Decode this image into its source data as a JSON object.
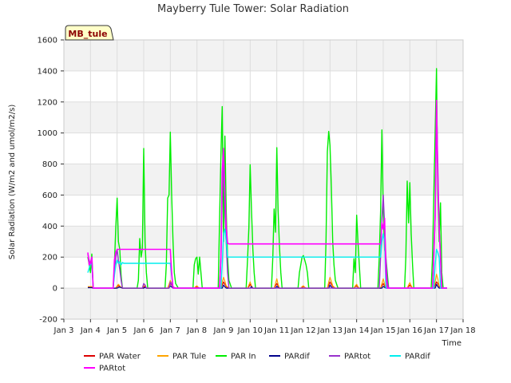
{
  "chart_data": {
    "type": "line",
    "title": "Mayberry Tule Tower: Solar Radiation",
    "xlabel": "Time",
    "ylabel": "Solar Radiation (W/m2 and umol/m2/s)",
    "badge": "MB_tule",
    "xlim": [
      3,
      18
    ],
    "ylim": [
      -200,
      1600
    ],
    "x_ticks": [
      3,
      4,
      5,
      6,
      7,
      8,
      9,
      10,
      11,
      12,
      13,
      14,
      15,
      16,
      17,
      18
    ],
    "x_tick_labels": [
      "Jan 3",
      "Jan 4",
      "Jan 5",
      "Jan 6",
      "Jan 7",
      "Jan 8",
      "Jan 9",
      "Jan 10",
      "Jan 11",
      "Jan 12",
      "Jan 13",
      "Jan 14",
      "Jan 15",
      "Jan 16",
      "Jan 17",
      "Jan 18"
    ],
    "y_ticks": [
      -200,
      0,
      200,
      400,
      600,
      800,
      1000,
      1200,
      1400,
      1600
    ],
    "y_tick_labels": [
      "-200",
      "0",
      "200",
      "400",
      "600",
      "800",
      "1000",
      "1200",
      "1400",
      "1600"
    ],
    "bands": [
      [
        -200,
        0
      ],
      [
        200,
        400
      ],
      [
        600,
        800
      ],
      [
        1000,
        1200
      ],
      [
        1400,
        1600
      ]
    ],
    "series": [
      {
        "name": "PAR Water",
        "color": "#dd0000",
        "width": 1.2,
        "x": [
          3.9,
          4.05,
          4.1,
          4.5,
          4.95,
          5.0,
          5.05,
          5.1,
          5.15,
          5.2,
          5.3,
          5.95,
          6.0,
          6.05,
          6.1,
          6.9,
          6.95,
          7.0,
          7.05,
          7.1,
          7.2,
          7.9,
          7.95,
          8.0,
          8.05,
          8.1,
          8.9,
          8.95,
          9.0,
          9.05,
          9.1,
          9.2,
          9.9,
          9.95,
          10.0,
          10.05,
          10.1,
          10.9,
          10.95,
          11.0,
          11.05,
          11.1,
          11.9,
          11.95,
          12.0,
          12.05,
          12.1,
          12.9,
          12.95,
          13.0,
          13.05,
          13.1,
          13.2,
          13.9,
          13.95,
          14.0,
          14.05,
          14.1,
          14.9,
          14.95,
          15.0,
          15.05,
          15.1,
          15.2,
          15.9,
          15.95,
          16.0,
          16.05,
          16.1,
          16.9,
          16.95,
          17.0,
          17.05,
          17.1,
          17.2,
          17.4
        ],
        "y": [
          5,
          5,
          0,
          0,
          0,
          10,
          15,
          10,
          5,
          0,
          0,
          0,
          8,
          10,
          0,
          0,
          15,
          30,
          20,
          5,
          0,
          0,
          5,
          8,
          3,
          0,
          0,
          20,
          40,
          25,
          10,
          0,
          0,
          10,
          25,
          10,
          0,
          0,
          15,
          30,
          15,
          0,
          0,
          5,
          10,
          5,
          0,
          0,
          20,
          40,
          25,
          10,
          0,
          0,
          10,
          15,
          5,
          0,
          0,
          15,
          30,
          15,
          5,
          0,
          0,
          10,
          20,
          10,
          0,
          0,
          20,
          40,
          30,
          10,
          0,
          0
        ]
      },
      {
        "name": "PAR Tule",
        "color": "#ffa500",
        "width": 1.2,
        "x": [
          3.9,
          4.05,
          4.1,
          4.5,
          4.95,
          5.0,
          5.05,
          5.1,
          5.15,
          5.2,
          5.3,
          5.95,
          6.0,
          6.05,
          6.1,
          6.9,
          6.95,
          7.0,
          7.05,
          7.1,
          7.2,
          7.9,
          7.95,
          8.0,
          8.05,
          8.1,
          8.9,
          8.95,
          9.0,
          9.05,
          9.1,
          9.2,
          9.9,
          9.95,
          10.0,
          10.05,
          10.1,
          10.9,
          10.95,
          11.0,
          11.05,
          11.1,
          11.9,
          11.95,
          12.0,
          12.05,
          12.1,
          12.9,
          12.95,
          13.0,
          13.05,
          13.1,
          13.2,
          13.9,
          13.95,
          14.0,
          14.05,
          14.1,
          14.9,
          14.95,
          15.0,
          15.05,
          15.1,
          15.2,
          15.9,
          15.95,
          16.0,
          16.05,
          16.1,
          16.9,
          16.95,
          17.0,
          17.05,
          17.1,
          17.2,
          17.4
        ],
        "y": [
          10,
          10,
          0,
          0,
          0,
          15,
          25,
          15,
          5,
          0,
          0,
          0,
          15,
          20,
          0,
          0,
          25,
          50,
          30,
          10,
          0,
          0,
          10,
          15,
          5,
          0,
          0,
          40,
          70,
          45,
          15,
          0,
          0,
          20,
          40,
          15,
          0,
          0,
          30,
          60,
          25,
          0,
          0,
          10,
          15,
          5,
          0,
          0,
          40,
          70,
          45,
          15,
          0,
          0,
          15,
          25,
          10,
          0,
          0,
          30,
          60,
          25,
          5,
          0,
          0,
          20,
          35,
          15,
          0,
          0,
          40,
          90,
          60,
          15,
          0,
          0
        ]
      },
      {
        "name": "PAR In",
        "color": "#00ee00",
        "width": 1.4,
        "x": [
          3.9,
          3.95,
          4.0,
          4.05,
          4.1,
          4.15,
          4.2,
          4.5,
          4.85,
          4.9,
          4.95,
          5.0,
          5.05,
          5.1,
          5.15,
          5.2,
          5.3,
          5.75,
          5.8,
          5.85,
          5.9,
          5.95,
          6.0,
          6.05,
          6.1,
          6.15,
          6.2,
          6.5,
          6.8,
          6.85,
          6.9,
          6.95,
          7.0,
          7.05,
          7.1,
          7.15,
          7.2,
          7.3,
          7.8,
          7.85,
          7.9,
          7.95,
          8.0,
          8.05,
          8.1,
          8.2,
          8.8,
          8.85,
          8.9,
          8.95,
          9.0,
          9.05,
          9.1,
          9.15,
          9.2,
          9.3,
          9.8,
          9.85,
          9.9,
          9.95,
          10.0,
          10.05,
          10.1,
          10.15,
          10.2,
          10.8,
          10.85,
          10.9,
          10.95,
          11.0,
          11.05,
          11.1,
          11.15,
          11.2,
          11.8,
          11.85,
          11.9,
          11.95,
          12.0,
          12.05,
          12.1,
          12.15,
          12.2,
          12.8,
          12.85,
          12.9,
          12.95,
          13.0,
          13.05,
          13.1,
          13.15,
          13.2,
          13.3,
          13.8,
          13.85,
          13.9,
          13.95,
          14.0,
          14.05,
          14.1,
          14.15,
          14.8,
          14.85,
          14.9,
          14.95,
          15.0,
          15.05,
          15.1,
          15.15,
          15.2,
          15.3,
          15.8,
          15.85,
          15.9,
          15.95,
          16.0,
          16.05,
          16.1,
          16.15,
          16.2,
          16.8,
          16.85,
          16.9,
          16.95,
          17.0,
          17.05,
          17.1,
          17.15,
          17.2,
          17.25,
          17.4
        ],
        "y": [
          200,
          150,
          100,
          220,
          0,
          0,
          0,
          0,
          0,
          150,
          390,
          580,
          300,
          250,
          80,
          0,
          0,
          0,
          50,
          320,
          200,
          250,
          900,
          300,
          100,
          0,
          0,
          0,
          0,
          150,
          580,
          600,
          1005,
          600,
          300,
          100,
          30,
          0,
          0,
          0,
          150,
          190,
          200,
          90,
          200,
          0,
          0,
          440,
          860,
          1170,
          300,
          980,
          500,
          200,
          50,
          0,
          0,
          0,
          180,
          390,
          795,
          500,
          250,
          100,
          0,
          0,
          200,
          510,
          360,
          905,
          500,
          270,
          100,
          0,
          0,
          100,
          150,
          200,
          210,
          180,
          150,
          100,
          0,
          0,
          300,
          880,
          1010,
          920,
          650,
          300,
          150,
          50,
          0,
          0,
          0,
          190,
          100,
          470,
          300,
          150,
          0,
          0,
          200,
          500,
          1020,
          500,
          250,
          200,
          100,
          0,
          0,
          0,
          200,
          690,
          420,
          680,
          350,
          150,
          0,
          0,
          0,
          200,
          590,
          1000,
          1415,
          600,
          300,
          550,
          100,
          0,
          0
        ]
      },
      {
        "name": "PARdif",
        "color": "#00008b",
        "width": 1.2,
        "x": [
          3.9,
          4.05,
          4.1,
          4.5,
          5.0,
          5.1,
          5.15,
          5.2,
          6.0,
          6.05,
          6.1,
          6.95,
          7.0,
          7.05,
          7.1,
          8.0,
          8.05,
          8.1,
          8.95,
          9.0,
          9.05,
          9.1,
          10.0,
          10.05,
          10.1,
          10.95,
          11.0,
          11.05,
          11.1,
          12.95,
          13.0,
          13.05,
          13.1,
          14.95,
          15.0,
          15.05,
          15.1,
          16.95,
          17.0,
          17.05,
          17.1,
          17.4
        ],
        "y": [
          3,
          3,
          0,
          0,
          0,
          8,
          3,
          0,
          0,
          5,
          0,
          0,
          15,
          8,
          0,
          0,
          3,
          0,
          0,
          20,
          8,
          0,
          0,
          10,
          0,
          0,
          12,
          5,
          0,
          0,
          20,
          8,
          0,
          0,
          12,
          5,
          0,
          0,
          25,
          10,
          0,
          0
        ]
      },
      {
        "name": "PARtot",
        "color": "#9932cc",
        "width": 1.4,
        "x": [
          3.9,
          3.95,
          4.0,
          4.05,
          4.1,
          4.15,
          4.5,
          4.85,
          4.9,
          4.95,
          5.0,
          5.05,
          5.1,
          5.15,
          5.2,
          5.95,
          6.0,
          6.05,
          6.1,
          6.95,
          7.0,
          7.05,
          7.1,
          7.15,
          8.85,
          8.9,
          8.95,
          9.0,
          9.05,
          9.1,
          9.15,
          9.2,
          14.85,
          14.9,
          14.95,
          15.0,
          15.05,
          15.1,
          15.15,
          15.2,
          16.85,
          16.9,
          16.95,
          17.0,
          17.05,
          17.1,
          17.15,
          17.2,
          17.4
        ],
        "y": [
          220,
          180,
          150,
          200,
          0,
          0,
          0,
          0,
          100,
          200,
          250,
          180,
          120,
          50,
          0,
          0,
          30,
          20,
          0,
          0,
          40,
          25,
          10,
          0,
          0,
          200,
          600,
          850,
          500,
          300,
          100,
          0,
          0,
          200,
          450,
          600,
          400,
          200,
          50,
          0,
          0,
          200,
          450,
          1210,
          800,
          400,
          200,
          0,
          0
        ]
      },
      {
        "name": "PARdif",
        "color": "#00eeee",
        "width": 1.4,
        "x": [
          3.9,
          3.95,
          4.0,
          4.05,
          4.1,
          4.2,
          4.5,
          4.85,
          4.9,
          4.95,
          5.0,
          5.05,
          5.1,
          5.15,
          5.2,
          5.25,
          5.3,
          6.0,
          6.5,
          7.0,
          7.05,
          7.1,
          8.9,
          8.95,
          9.0,
          9.05,
          9.1,
          9.15,
          9.2,
          13.0,
          14.0,
          14.9,
          14.95,
          15.0,
          15.05,
          15.1,
          16.9,
          16.95,
          17.0,
          17.05,
          17.1,
          17.15,
          17.4
        ],
        "y": [
          100,
          130,
          160,
          150,
          0,
          0,
          0,
          0,
          80,
          150,
          180,
          160,
          170,
          150,
          165,
          160,
          160,
          160,
          160,
          160,
          80,
          0,
          0,
          150,
          350,
          380,
          300,
          200,
          200,
          200,
          200,
          200,
          300,
          350,
          300,
          0,
          0,
          150,
          250,
          230,
          200,
          0,
          0
        ]
      },
      {
        "name": "PARtot",
        "color": "#ff00ff",
        "width": 1.6,
        "x": [
          3.9,
          3.95,
          4.0,
          4.05,
          4.1,
          4.2,
          4.5,
          4.85,
          4.9,
          4.95,
          5.0,
          5.05,
          5.1,
          5.15,
          5.2,
          5.5,
          6.0,
          6.5,
          7.0,
          7.05,
          7.1,
          8.85,
          8.9,
          8.95,
          9.0,
          9.05,
          9.1,
          9.15,
          9.2,
          9.3,
          10.0,
          11.0,
          12.0,
          13.0,
          14.0,
          14.9,
          14.95,
          15.0,
          15.05,
          15.1,
          15.15,
          16.85,
          16.9,
          16.95,
          17.0,
          17.05,
          17.1,
          17.15,
          17.2,
          17.4
        ],
        "y": [
          230,
          150,
          160,
          200,
          0,
          0,
          0,
          0,
          180,
          230,
          250,
          250,
          250,
          250,
          250,
          250,
          250,
          250,
          250,
          100,
          0,
          0,
          200,
          750,
          900,
          600,
          400,
          290,
          285,
          285,
          285,
          285,
          285,
          285,
          285,
          285,
          420,
          380,
          450,
          100,
          0,
          0,
          200,
          480,
          1210,
          700,
          380,
          200,
          0,
          0
        ]
      }
    ],
    "legend": [
      {
        "name": "PAR Water",
        "color": "#dd0000"
      },
      {
        "name": "PAR Tule",
        "color": "#ffa500"
      },
      {
        "name": "PAR In",
        "color": "#00ee00"
      },
      {
        "name": "PARdif",
        "color": "#00008b"
      },
      {
        "name": "PARtot",
        "color": "#9932cc"
      },
      {
        "name": "PARdif",
        "color": "#00eeee"
      },
      {
        "name": "PARtot",
        "color": "#ff00ff"
      }
    ]
  }
}
